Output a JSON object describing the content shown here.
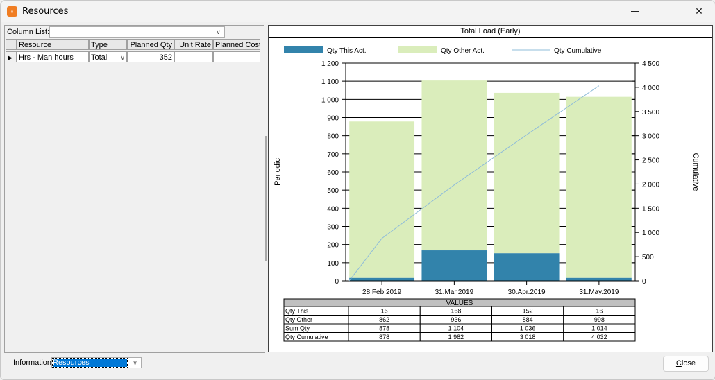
{
  "window": {
    "title": "Resources",
    "icon": "app-logo-icon",
    "controls": [
      "minimize-icon",
      "maximize-icon",
      "close-icon"
    ]
  },
  "left_pane": {
    "column_list_label": "Column List:",
    "column_list_value": "",
    "grid": {
      "headers": [
        "Resource",
        "Type",
        "Planned Qty",
        "Unit Rate",
        "Planned Cost"
      ],
      "rows": [
        {
          "resource": "Hrs - Man hours",
          "type": "Total",
          "planned_qty": "352",
          "unit_rate": "",
          "planned_cost": ""
        }
      ]
    }
  },
  "chart_panel": {
    "title": "Total Load (Early)"
  },
  "colors": {
    "qty_this": "#3283ab",
    "qty_other": "#daedbb",
    "cumulative_line": "#8fbcd9"
  },
  "chart_data": {
    "type": "bar",
    "stacked": true,
    "title": "Total Load (Early)",
    "categories": [
      "28.Feb.2019",
      "31.Mar.2019",
      "30.Apr.2019",
      "31.May.2019"
    ],
    "series": [
      {
        "name": "Qty This Act.",
        "type": "bar",
        "axis": "left",
        "values": [
          16,
          168,
          152,
          16
        ]
      },
      {
        "name": "Qty Other Act.",
        "type": "bar",
        "axis": "left",
        "values": [
          862,
          936,
          884,
          998
        ]
      },
      {
        "name": "Qty Cumulative",
        "type": "line",
        "axis": "right",
        "values": [
          878,
          1982,
          3018,
          4032
        ]
      }
    ],
    "ylabel": "Periodic",
    "ylabel_right": "Cumulative",
    "ylim": [
      0,
      1200
    ],
    "ylim_right": [
      0,
      4500
    ],
    "yticks": [
      0,
      100,
      200,
      300,
      400,
      500,
      600,
      700,
      800,
      900,
      1000,
      1100,
      1200
    ],
    "ytick_labels": [
      "0",
      "100",
      "200",
      "300",
      "400",
      "500",
      "600",
      "700",
      "800",
      "900",
      "1 000",
      "1 100",
      "1 200"
    ],
    "yticks_right": [
      0,
      500,
      1000,
      1500,
      2000,
      2500,
      3000,
      3500,
      4000,
      4500
    ],
    "ytick_labels_right": [
      "0",
      "500",
      "1 000",
      "1 500",
      "2 000",
      "2 500",
      "3 000",
      "3 500",
      "4 000",
      "4 500"
    ],
    "grid": true,
    "legend_position": "top",
    "values_table": {
      "header": "VALUES",
      "rows": [
        {
          "label": "Qty This",
          "values": [
            "16",
            "168",
            "152",
            "16"
          ]
        },
        {
          "label": "Qty Other",
          "values": [
            "862",
            "936",
            "884",
            "998"
          ]
        },
        {
          "label": "Sum Qty",
          "values": [
            "878",
            "1 104",
            "1 036",
            "1 014"
          ]
        },
        {
          "label": "Qty Cumulative",
          "values": [
            "878",
            "1 982",
            "3 018",
            "4 032"
          ]
        }
      ]
    }
  },
  "bottom_bar": {
    "information_label": "Information:",
    "information_value": "Resources",
    "close_label": "Close"
  }
}
